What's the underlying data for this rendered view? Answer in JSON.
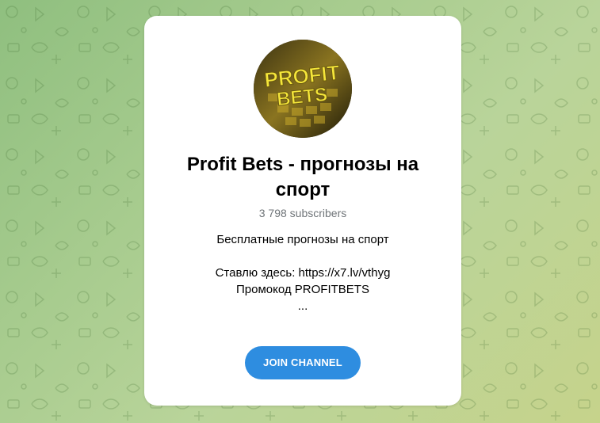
{
  "channel": {
    "title": "Profit Bets - прогнозы на спорт",
    "subscribers": "3 798 subscribers",
    "avatar_text_line1": "PROFIT",
    "avatar_text_line2": "BETS",
    "description": {
      "line1": "Бесплатные прогнозы на спорт",
      "line2": "",
      "line3": "Ставлю здесь: https://x7.lv/vthyg",
      "line4": "Промокод PROFITBETS",
      "line5": "..."
    }
  },
  "actions": {
    "join_label": "JOIN CHANNEL"
  },
  "colors": {
    "accent": "#2e8de0",
    "background": "#a8cc8f",
    "card": "#ffffff",
    "muted_text": "#707579"
  },
  "icons": {
    "background_pattern": "doodle-pattern-icon"
  }
}
